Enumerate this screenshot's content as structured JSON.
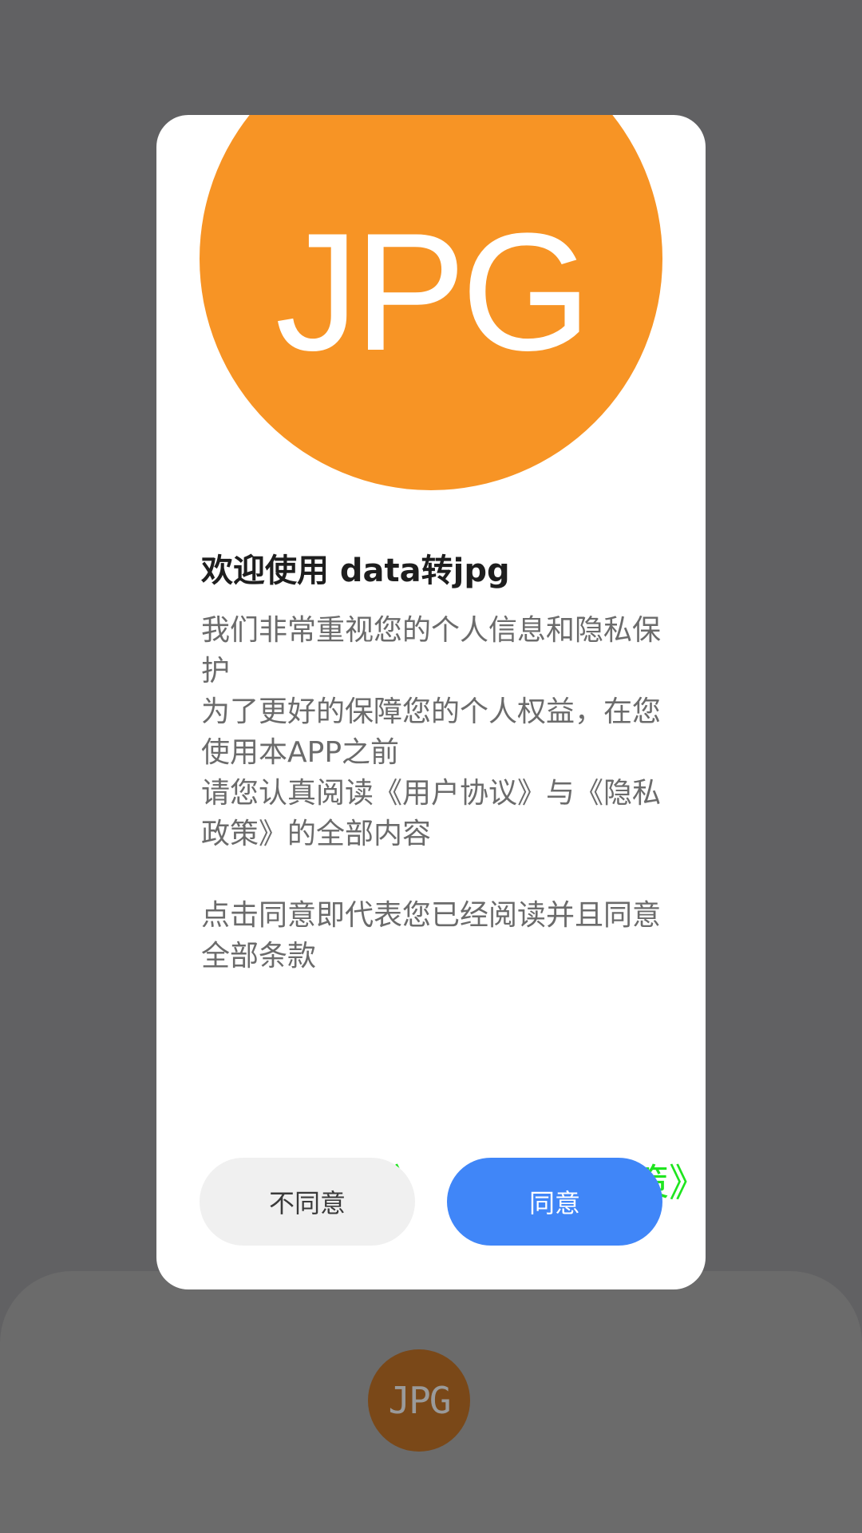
{
  "background": {
    "logo_text": "JPG"
  },
  "dialog": {
    "hero_logo_text": "JPG",
    "title": "欢迎使用 data转jpg",
    "body": {
      "p1": "我们非常重视您的个人信息和隐私保护",
      "p2": "为了更好的保障您的个人权益，在您使用本APP之前",
      "p3": "请您认真阅读《用户协议》与《隐私政策》的全部内容",
      "p4": "点击同意即代表您已经阅读并且同意全部条款"
    },
    "links": {
      "user_agreement": "《用户协议》",
      "privacy_policy": "《隐私政策》"
    },
    "buttons": {
      "disagree": "不同意",
      "agree": "同意"
    }
  },
  "colors": {
    "overlay": "#616163",
    "logo_orange": "#f79425",
    "link_green": "#1fe51f",
    "agree_blue": "#4086f8",
    "disagree_gray": "#f0f0f0"
  }
}
